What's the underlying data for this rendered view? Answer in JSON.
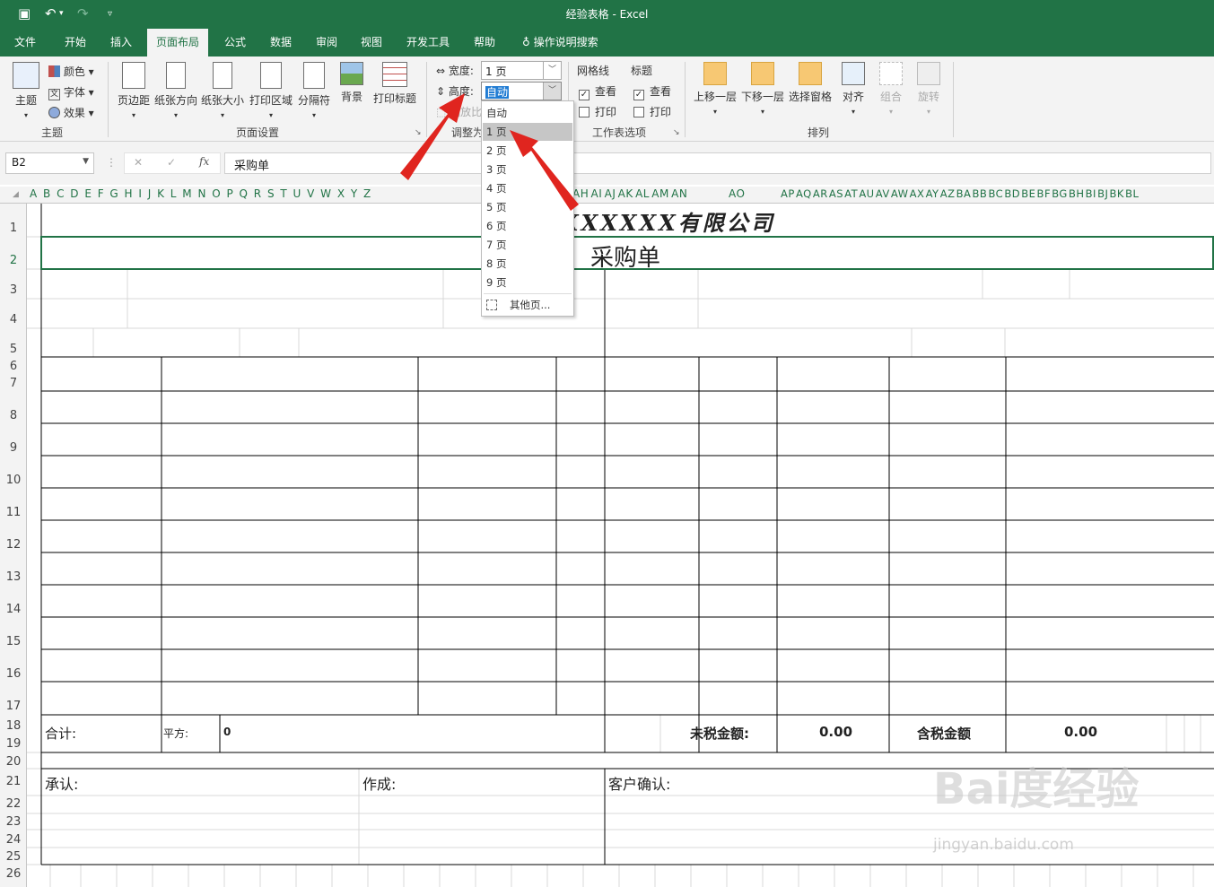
{
  "titlebar": {
    "title": "经验表格  -  Excel",
    "save_icon": "save-icon",
    "undo_icon": "undo-icon"
  },
  "tabs": [
    "文件",
    "开始",
    "插入",
    "页面布局",
    "公式",
    "数据",
    "审阅",
    "视图",
    "开发工具",
    "帮助",
    "操作说明搜索"
  ],
  "ribbon": {
    "theme": {
      "themes": "主题",
      "colors": "颜色",
      "fonts": "字体",
      "effects": "效果",
      "group": "主题"
    },
    "page_setup": {
      "margins": "页边距",
      "orientation": "纸张方向",
      "size": "纸张大小",
      "print_area": "打印区域",
      "breaks": "分隔符",
      "background": "背景",
      "print_titles": "打印标题",
      "group": "页面设置"
    },
    "scale": {
      "width_label": "宽度:",
      "width_value": "1 页",
      "height_label": "高度:",
      "height_value": "自动",
      "scale_label": "缩放比",
      "group": "调整为"
    },
    "sheet_options": {
      "gridlines": "网格线",
      "headings": "标题",
      "view": "查看",
      "print": "打印",
      "group": "工作表选项"
    },
    "arrange": {
      "bring_forward": "上移一层",
      "send_backward": "下移一层",
      "selection_pane": "选择窗格",
      "align": "对齐",
      "group_btn": "组合",
      "rotate": "旋转",
      "group": "排列"
    }
  },
  "dropdown_items": [
    "自动",
    "1 页",
    "2 页",
    "3 页",
    "4 页",
    "5 页",
    "6 页",
    "7 页",
    "8 页",
    "9 页"
  ],
  "dropdown_more": "其他页...",
  "dropdown_selected": 1,
  "formula": {
    "namebox": "B2",
    "content": "采购单",
    "cancel": "✕",
    "enter": "✓",
    "fx": "fx"
  },
  "columns_left": "A B C D E F G H I J K L M N O P Q R S T U V W X Y Z",
  "columns_mid": "AH AI AJ AK AL AM AN",
  "column_ao": "AO",
  "columns_right": "AP AQ AR AS AT AU AV AW AX AY AZ BA BB BC BD BE BF BG BH BI BJ BK BL",
  "rows": [
    "1",
    "2",
    "3",
    "4",
    "5",
    "6",
    "7",
    "8",
    "9",
    "10",
    "11",
    "12",
    "13",
    "14",
    "15",
    "16",
    "17",
    "18",
    "19",
    "20",
    "21",
    "22",
    "23",
    "24",
    "25",
    "26"
  ],
  "sheet": {
    "company": "XXXXXX有限公司",
    "title": "采购单",
    "total_label": "合计:",
    "area_label": "平方:",
    "area_value": "0",
    "pre_tax_label": "未税金额:",
    "pre_tax_value": "0.00",
    "tax_incl_label": "含税金额",
    "tax_incl_value": "0.00",
    "approve": "承认:",
    "made_by": "作成:",
    "customer_confirm": "客户确认:"
  },
  "watermark": {
    "main": "Bai度经验",
    "sub": "jingyan.baidu.com"
  },
  "colors": {
    "excel_green": "#217346",
    "arrow": "#e0251f"
  }
}
